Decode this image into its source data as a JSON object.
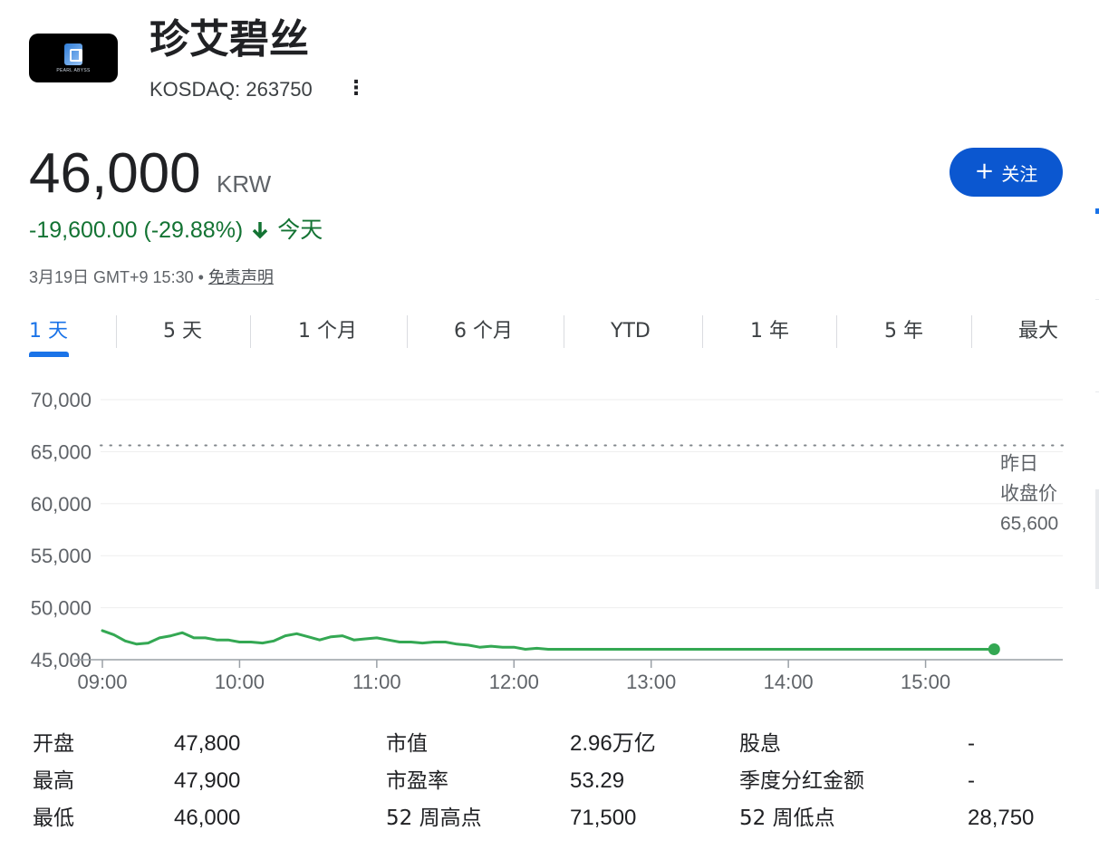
{
  "header": {
    "logo_text": "PEARL ABYSS",
    "title": "珍艾碧丝",
    "ticker": "KOSDAQ: 263750",
    "more_icon": "vertical-dots-icon"
  },
  "quote": {
    "price": "46,000",
    "currency": "KRW",
    "change": "-19,600.00 (-29.88%)",
    "change_icon": "arrow-down-icon",
    "period": "今天",
    "timestamp": "3月19日 GMT+9 15:30",
    "separator": "•",
    "disclaimer": "免责声明",
    "down_color": "#137333"
  },
  "follow": {
    "icon": "plus-icon",
    "label": "关注",
    "color": "#0b57d0"
  },
  "tabs": [
    {
      "label": "1 天",
      "active": true
    },
    {
      "label": "5 天",
      "active": false
    },
    {
      "label": "1 个月",
      "active": false
    },
    {
      "label": "6 个月",
      "active": false
    },
    {
      "label": "YTD",
      "active": false
    },
    {
      "label": "1 年",
      "active": false
    },
    {
      "label": "5 年",
      "active": false
    },
    {
      "label": "最大",
      "active": false
    }
  ],
  "chart_data": {
    "type": "line",
    "ylim": [
      45000,
      70000
    ],
    "yticks": [
      70000,
      65000,
      60000,
      55000,
      50000,
      45000
    ],
    "ytick_labels": [
      "70,000",
      "65,000",
      "60,000",
      "55,000",
      "50,000",
      "45,000"
    ],
    "xlim": [
      "09:00",
      "16:00"
    ],
    "xticks": [
      "09:00",
      "10:00",
      "11:00",
      "12:00",
      "13:00",
      "14:00",
      "15:00"
    ],
    "line_color": "#34a853",
    "previous_close": 65600,
    "previous_close_label": [
      "昨日",
      "收盘价",
      "65,600"
    ],
    "series": [
      {
        "x": [
          "09:00",
          "09:05",
          "09:10",
          "09:15",
          "09:20",
          "09:25",
          "09:30",
          "09:35",
          "09:40",
          "09:45",
          "09:50",
          "09:55",
          "10:00",
          "10:05",
          "10:10",
          "10:15",
          "10:20",
          "10:25",
          "10:30",
          "10:35",
          "10:40",
          "10:45",
          "10:50",
          "10:55",
          "11:00",
          "11:05",
          "11:10",
          "11:15",
          "11:20",
          "11:25",
          "11:30",
          "11:35",
          "11:40",
          "11:45",
          "11:50",
          "11:55",
          "12:00",
          "12:05",
          "12:10",
          "12:15",
          "12:20",
          "13:00",
          "14:00",
          "15:00",
          "15:30"
        ],
        "values": [
          47800,
          47400,
          46800,
          46500,
          46600,
          47100,
          47300,
          47600,
          47100,
          47100,
          46900,
          46900,
          46700,
          46700,
          46600,
          46800,
          47300,
          47500,
          47200,
          46900,
          47200,
          47300,
          46900,
          47000,
          47100,
          46900,
          46700,
          46700,
          46600,
          46700,
          46700,
          46500,
          46400,
          46200,
          46300,
          46200,
          46200,
          46000,
          46100,
          46000,
          46000,
          46000,
          46000,
          46000,
          46000
        ]
      }
    ]
  },
  "stats": [
    {
      "label": "开盘",
      "value": "47,800"
    },
    {
      "label": "最高",
      "value": "47,900"
    },
    {
      "label": "最低",
      "value": "46,000"
    },
    {
      "label": "市值",
      "value": "2.96万亿"
    },
    {
      "label": "市盈率",
      "value": "53.29"
    },
    {
      "label": "52 周高点",
      "value": "71,500"
    },
    {
      "label": "股息",
      "value": "-"
    },
    {
      "label": "季度分红金额",
      "value": "-"
    },
    {
      "label": "52 周低点",
      "value": "28,750"
    }
  ]
}
